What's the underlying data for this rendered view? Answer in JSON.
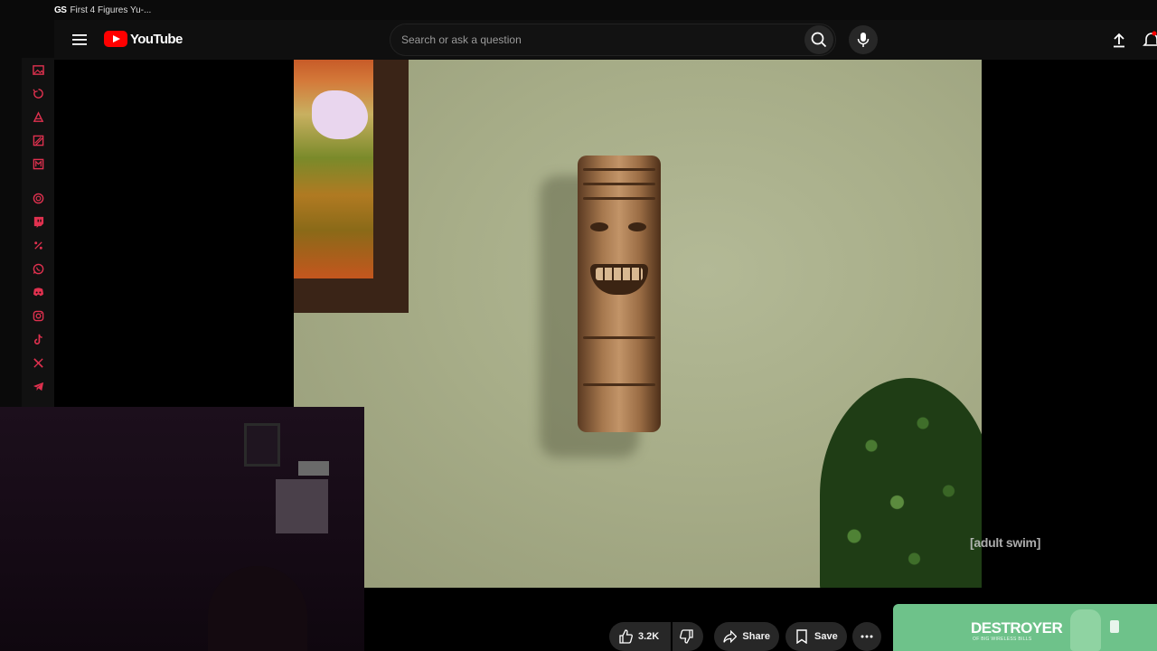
{
  "browser": {
    "tab_favicon_text": "GS",
    "tab_title": "First 4 Figures Yu-..."
  },
  "dock": {
    "icons": [
      "image-icon",
      "history-icon",
      "ai-icon",
      "playground-icon",
      "memo-icon",
      "chatgpt-icon",
      "twitch-icon",
      "percent-icon",
      "whatsapp-icon",
      "discord-icon",
      "instagram-icon",
      "tiktok-icon",
      "x-icon",
      "telegram-icon"
    ],
    "accent_color": "#e0314f"
  },
  "header": {
    "logo_text": "YouTube",
    "search_placeholder": "Search or ask a question",
    "brand_color": "#ff0000"
  },
  "video": {
    "watermark": "[adult swim]"
  },
  "actions": {
    "like_count": "3.2K",
    "share_label": "Share",
    "save_label": "Save"
  },
  "ad": {
    "title": "DESTROYER",
    "subtitle": "OF BIG WIRELESS BILLS",
    "color": "#6ec28a"
  }
}
